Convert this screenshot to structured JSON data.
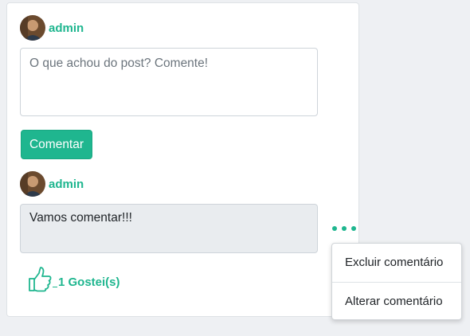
{
  "post_box": {
    "username": "admin",
    "comment_placeholder": "O que achou do post? Comente!",
    "comment_button": "Comentar"
  },
  "comment": {
    "username": "admin",
    "text": "Vamos comentar!!!",
    "likes_label": "1 Gostei(s)"
  },
  "comment_menu": {
    "items": [
      {
        "label": "Excluir comentário"
      },
      {
        "label": "Alterar comentário"
      }
    ]
  },
  "colors": {
    "accent": "#1fb68f",
    "page_background": "#eef0f3"
  },
  "icons": {
    "more": "more-dots-icon",
    "like": "thumbs-up-icon"
  }
}
